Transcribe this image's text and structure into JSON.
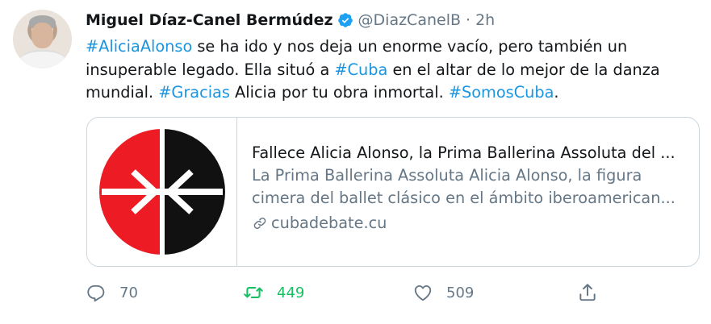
{
  "tweet": {
    "author_name": "Miguel Díaz-Canel Bermúdez",
    "handle": "@DiazCanelB",
    "separator": "·",
    "time": "2h",
    "text": {
      "line1": {
        "tag1": "#AliciaAlonso",
        "rest1": " se ha ido y nos deja un enorme vacío, pero también un"
      },
      "line2": {
        "pre2": "insuperable legado. Ella situó a ",
        "tag2": "#Cuba",
        "post2": " en el altar de lo mejor de la danza"
      },
      "line3": {
        "pre3": "mundial. ",
        "tag3": "#Gracias",
        "mid3": " Alicia por tu obra inmortal. ",
        "tag4": "#SomosCuba",
        "end3": "."
      }
    }
  },
  "card": {
    "title": "Fallece Alicia Alonso, la Prima Ballerina Assoluta del ...",
    "desc_line1": "La Prima Ballerina Assoluta Alicia Alonso, la figura",
    "desc_line2": "cimera del ballet clásico en el ámbito iberoamerican...",
    "domain": "cubadebate.cu",
    "logo_colors": {
      "left": "#ed1c24",
      "right": "#111111",
      "arrows": "#ffffff"
    }
  },
  "actions": {
    "reply_count": "70",
    "retweet_count": "449",
    "like_count": "509"
  },
  "colors": {
    "link": "#1b95e0",
    "muted": "#657786",
    "retweet_active": "#17bf63",
    "verified": "#1da1f2"
  },
  "icons": [
    "verified-badge-icon",
    "link-icon",
    "reply-icon",
    "retweet-icon",
    "like-icon",
    "share-icon"
  ]
}
